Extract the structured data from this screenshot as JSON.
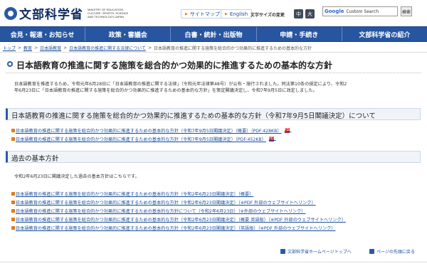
{
  "header": {
    "logo_text": "文部科学省",
    "logo_sub": "MINISTRY OF EDUCATION, CULTURE, SPORTS, SCIENCE AND TECHNOLOGY-JAPAN",
    "sitemap": "サイトマップ",
    "english": "English",
    "font_size_label": "文字サイズの変更",
    "font_small": "中",
    "font_large": "大",
    "search_brand": "Google",
    "search_placeholder": "Custom Search",
    "search_button": "検索"
  },
  "nav": [
    "会見・報道・お知らせ",
    "政策・審議会",
    "白書・統計・出版物",
    "申請・手続き",
    "文部科学省の紹介"
  ],
  "breadcrumb": [
    "トップ",
    "教育",
    "日本語教育",
    "日本語教育の推進に関する法律について",
    "日本語教育の推進に関する施策を総合的かつ効果的に推進するための基本的な方針"
  ],
  "page_title": "日本語教育の推進に関する施策を総合的かつ効果的に推進するための基本的な方針",
  "intro": {
    "line1": "日本語教育を推進するため、令和元年6月28日に「日本語教育の推進に関する法律」（令和元年法律第48号）が公布・施行されました。同法第10条の規定により、令和2",
    "line2": "年6月23日に「日本語教育の推進に関する施策を総合的かつ効果的に推進するための基本的な方針」を策定閣議決定し、令和7年9月5日に改定しました。"
  },
  "section1": {
    "title": "日本語教育の推進に関する施策を総合的かつ効果的に推進するための基本的な方針（令和7年9月5日閣議決定）について",
    "links": [
      "日本語教育の推進に関する施策を総合的かつ効果的に推進するための基本的な方針（令和7年9月5日閣議決定）（概要）（PDF:428KB）",
      "日本語教育の推進に関する施策を総合的かつ効果的に推進するための基本的な方針（令和7年9月5日閣議決定）（PDF:452KB）"
    ],
    "pdf_label": "PDF"
  },
  "section2": {
    "title": "過去の基本方針",
    "text": "令和2年6月23日に閣議決定した過去の基本方針はこちらです。",
    "links": [
      "日本語教育の推進に関する施策を総合的かつ効果的に推進するための基本的な方針（令和2年6月23日閣議決定）（概要）",
      "日本語教育の推進に関する施策を総合的かつ効果的に推進するための基本的な方針（令和2年6月23日閣議決定）（※PDF 外部のウェブサイトへリンク）",
      "日本語教育の推進に関する施策を総合的かつ効果的に推進するための基本的な方針について（令和2年6月23日）（※外部のウェブサイトへリンク）",
      "日本語教育の推進に関する施策を総合的かつ効果的に推進するための基本的な方針（令和2年6月23日閣議決定）（概要 英語版）（※PDF 外部のウェブサイトへリンク）",
      "日本語教育の推進に関する施策を総合的かつ効果的に推進するための基本的な方針（令和2年6月23日閣議決定）（英語版）（※PDF 外部のウェブサイトへリンク）"
    ]
  },
  "footer": {
    "home": "文部科学省ホームページトップへ",
    "top": "ページの先頭に戻る"
  }
}
